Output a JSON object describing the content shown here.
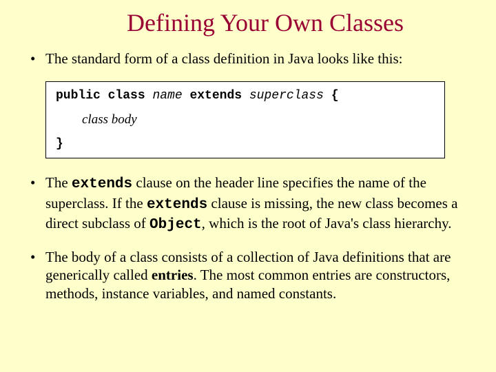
{
  "title": "Defining Your Own Classes",
  "bullets": {
    "b1": "The standard form of a class definition in Java looks like this:",
    "b2_p1": "The ",
    "b2_kw1": "extends",
    "b2_p2": " clause on the header line specifies the name of the superclass.  If the ",
    "b2_kw2": "extends",
    "b2_p3": " clause is missing, the new class becomes a direct subclass of ",
    "b2_kw3": "Object",
    "b2_p4": ", which is the root of Java's class hierarchy.",
    "b3_p1": "The body of a class consists of a collection of Java definitions that are generically called ",
    "b3_em": "entries",
    "b3_p2": ".  The most common entries are constructors, methods, instance variables, and named constants."
  },
  "code": {
    "kw_public": "public class ",
    "name": "name",
    "kw_extends": " extends ",
    "superclass": "superclass",
    "brace_open": " {",
    "body": "class body",
    "brace_close": "}"
  }
}
